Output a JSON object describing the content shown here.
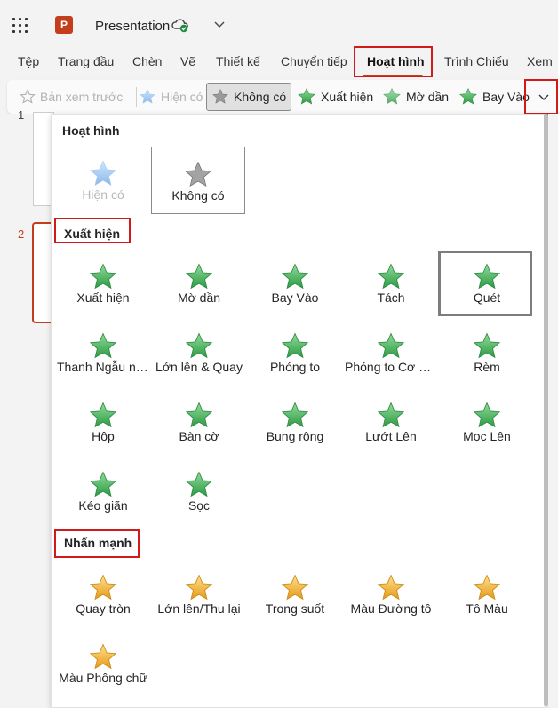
{
  "app": {
    "title": "Presentation",
    "logo_letter": "P"
  },
  "tabs": [
    "Tệp",
    "Trang đầu",
    "Chèn",
    "Vẽ",
    "Thiết kế",
    "Chuyển tiếp",
    "Hoạt hình",
    "Trình Chiếu",
    "Xem"
  ],
  "active_tab": "Hoạt hình",
  "ribbon": {
    "preview": "Bản xem trước",
    "current": "Hiện có",
    "none": "Không có",
    "appear": "Xuất hiện",
    "fade": "Mờ dần",
    "fly_in": "Bay Vào"
  },
  "slides": {
    "first": "1",
    "second": "2"
  },
  "gallery": {
    "section_animation": "Hoạt hình",
    "current_label": "Hiện có",
    "none_label": "Không có",
    "section_entrance": "Xuất hiện",
    "entrance": [
      "Xuất hiện",
      "Mờ dần",
      "Bay Vào",
      "Tách",
      "Quét",
      "Thanh Ngẫu nhiên",
      "Lớn lên & Quay",
      "Phóng to",
      "Phóng to Cơ bản",
      "Rèm",
      "Hộp",
      "Bàn cờ",
      "Bung rộng",
      "Lướt Lên",
      "Mọc Lên",
      "Kéo giãn",
      "Sọc"
    ],
    "section_emphasis": "Nhấn mạnh",
    "emphasis": [
      "Quay tròn",
      "Lớn lên/Thu lại",
      "Trong suốt",
      "Màu Đường tô",
      "Tô Màu",
      "Màu Phông chữ"
    ]
  },
  "colors": {
    "brand": "#c43e1c",
    "highlight": "#d11b1b",
    "entrance": "#4caf5a",
    "emphasis": "#f2b233"
  }
}
